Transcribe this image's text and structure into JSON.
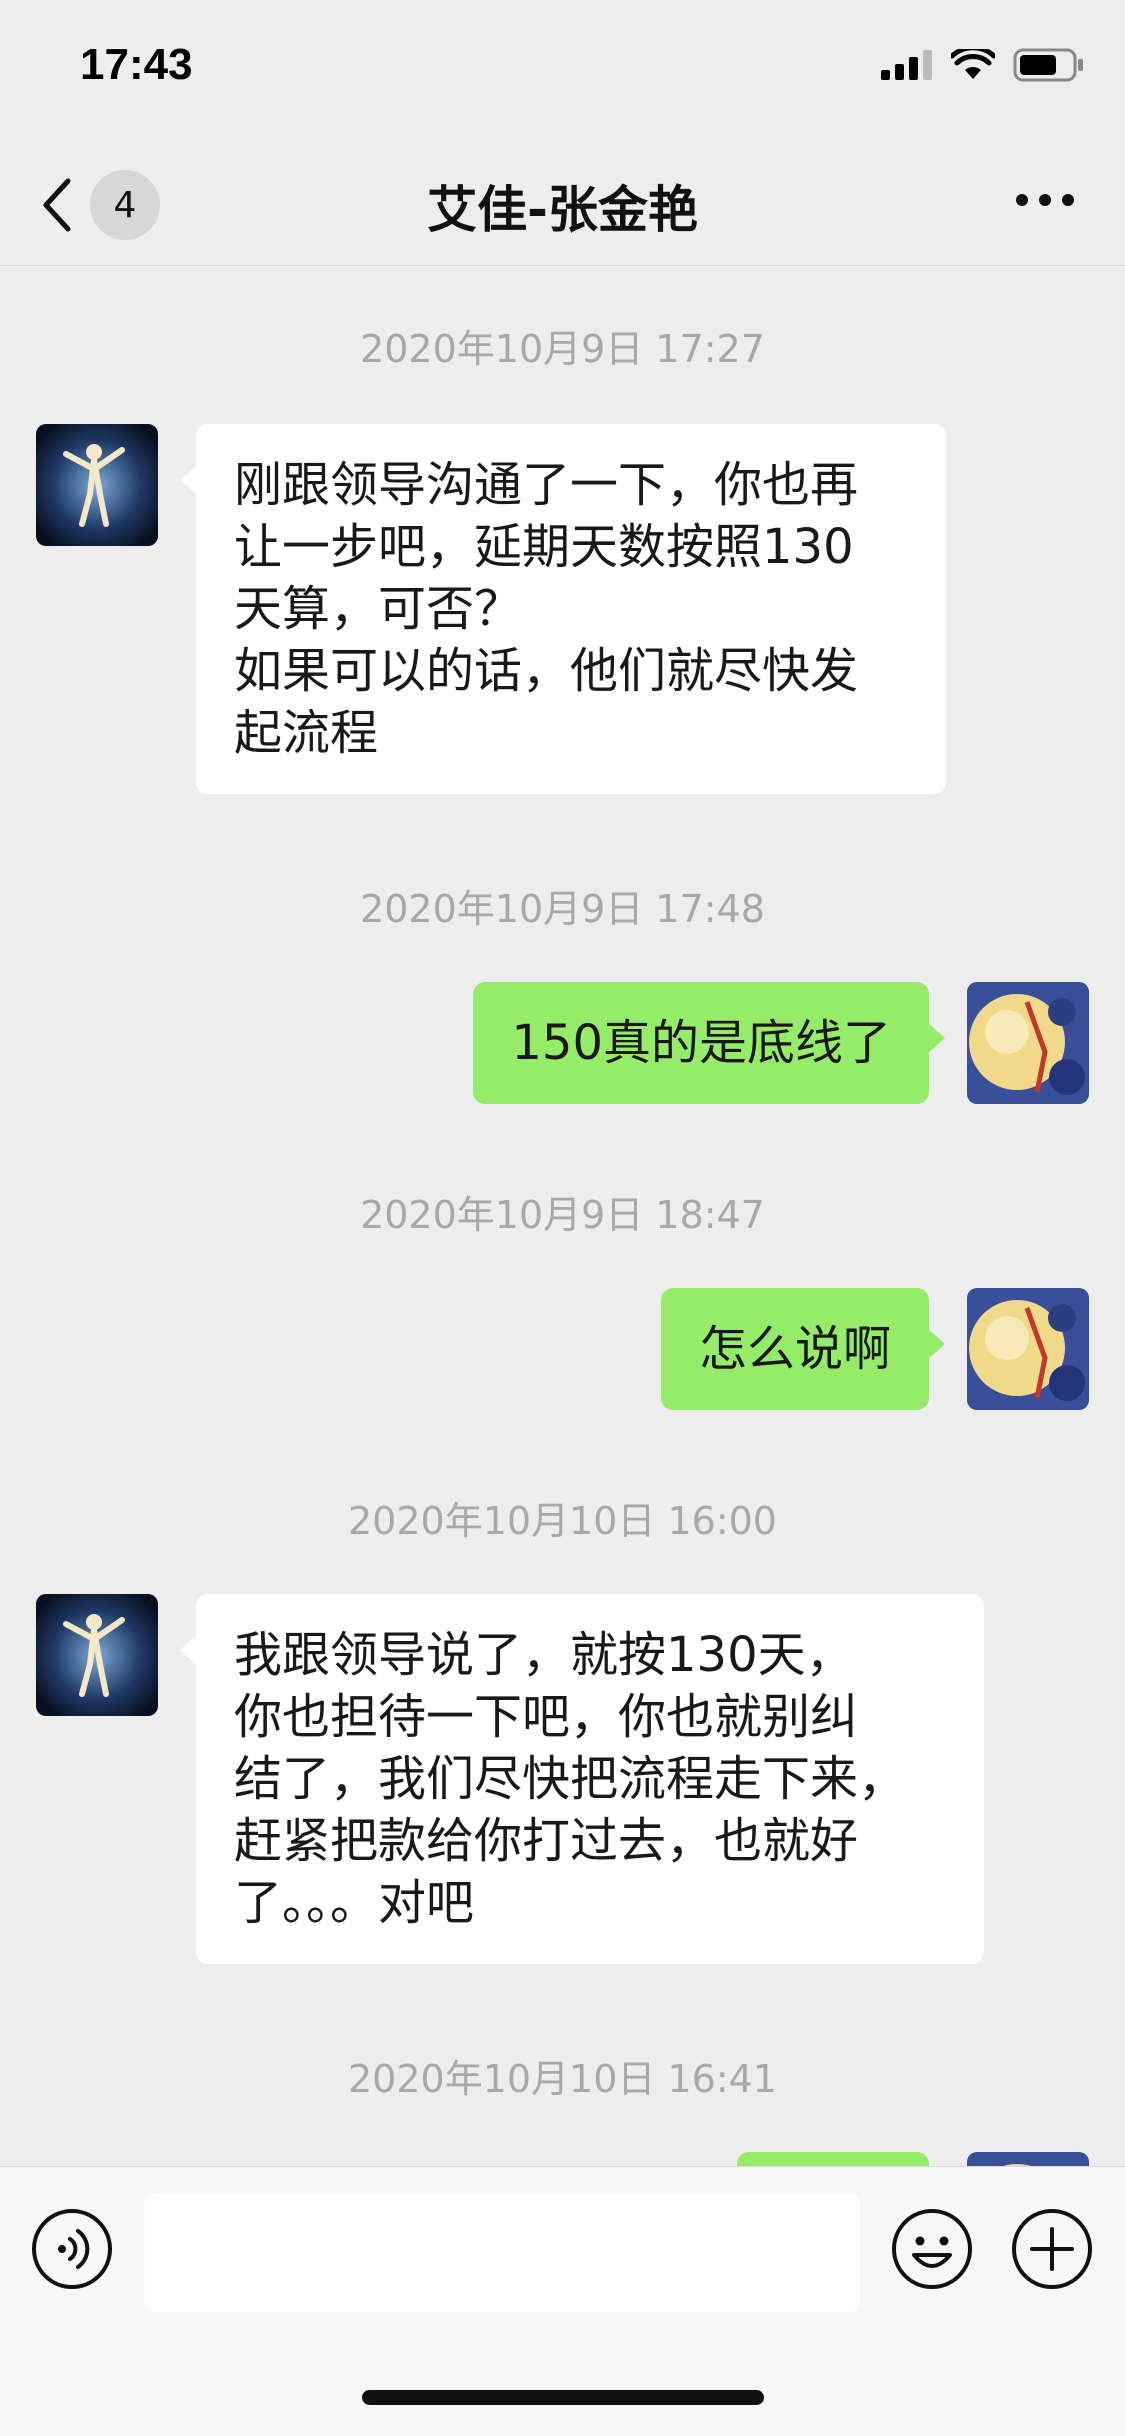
{
  "status_bar": {
    "time": "17:43",
    "icons": [
      "signal-icon",
      "wifi-icon",
      "battery-icon"
    ]
  },
  "nav": {
    "back_icon": "chevron-left-icon",
    "unread_count": "4",
    "title": "艾佳-张金艳",
    "more_icon": "more-dots-icon"
  },
  "messages": [
    {
      "timestamp": "2020年10月9日 17:27",
      "direction": "incoming",
      "lines": [
        "刚跟领导沟通了一下，你也再",
        "让一步吧，延期天数按照130",
        "天算，可否？",
        "如果可以的话，他们就尽快发",
        "起流程"
      ]
    },
    {
      "timestamp": "2020年10月9日 17:48",
      "direction": "outgoing",
      "lines": [
        "150真的是底线了"
      ]
    },
    {
      "timestamp": "2020年10月9日 18:47",
      "direction": "outgoing",
      "lines": [
        "怎么说啊"
      ]
    },
    {
      "timestamp": "2020年10月10日 16:00",
      "direction": "incoming",
      "lines": [
        "我跟领导说了，就按130天，",
        "你也担待一下吧，你也就别纠",
        "结了，我们尽快把流程走下来，",
        "赶紧把款给你打过去，也就好",
        "了。。。对吧"
      ]
    },
    {
      "timestamp": "2020年10月10日 16:41",
      "direction": "outgoing",
      "lines": []
    }
  ],
  "input_bar": {
    "voice_icon": "voice-icon",
    "input_value": "",
    "emoji_icon": "emoji-icon",
    "plus_icon": "plus-icon"
  },
  "colors": {
    "background": "#ededed",
    "incoming_bubble": "#ffffff",
    "outgoing_bubble": "#95ec69",
    "timestamp_text": "#a8a8a8"
  }
}
